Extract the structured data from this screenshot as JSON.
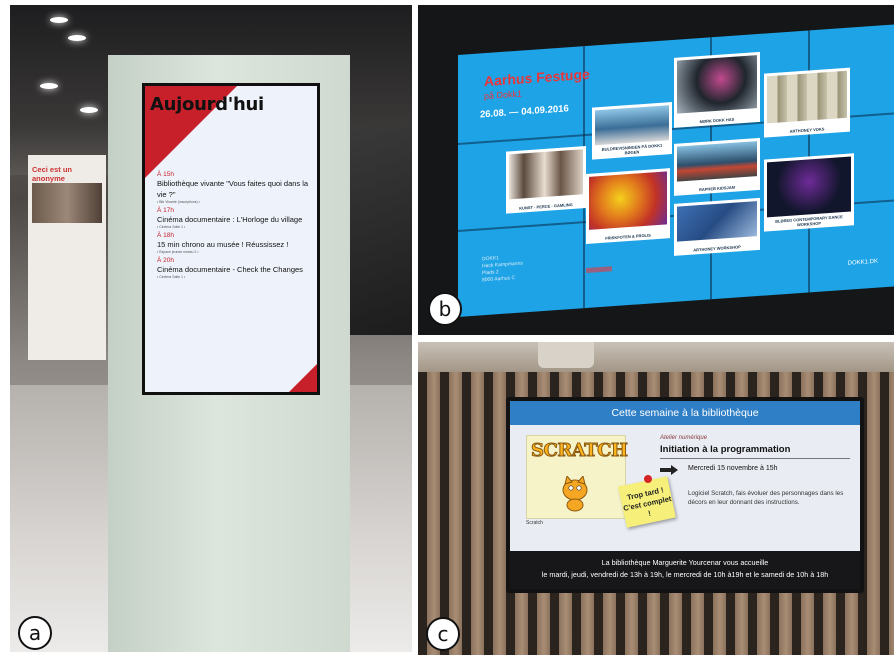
{
  "panels": {
    "a": {
      "label": "a",
      "screen": {
        "heading": "Aujourd'hui",
        "events": [
          {
            "time": "À 15h",
            "title": "Bibliothèque vivante \"Vous faites quoi dans la vie ?\"",
            "sub": "• Bib Vivante (inscriptions) •"
          },
          {
            "time": "À 17h",
            "title": "Cinéma documentaire : L'Horloge du village",
            "sub": "• Cinéma Salle 1 •"
          },
          {
            "time": "À 18h",
            "title": "15 min chrono au musée ! Réussissez !",
            "sub": "• Espace jeunes niveau 2 •"
          },
          {
            "time": "À 20h",
            "title": "Cinéma documentaire - Check the Changes",
            "sub": "• Cinéma Salle 1 •"
          }
        ]
      },
      "poster_title": "Ceci est un anonyme"
    },
    "b": {
      "label": "b",
      "festival_title": "Aarhus Festuge",
      "festival_subtitle": "på Dokk1",
      "festival_dates": "26.08. — 04.09.2016",
      "tiles": [
        {
          "caption": "KUNST · PERCE · GAMLING"
        },
        {
          "caption": "BULDREVISNINGEN PÅ DOKK1 BØGEN"
        },
        {
          "caption": "MØRK DOKK HAS"
        },
        {
          "caption": "ARTHONEY VOKS"
        },
        {
          "caption": "RAPHEB KIDSJAM"
        },
        {
          "caption": "FRISKFOTEN & PROLIS"
        },
        {
          "caption": "ARTHONEY WORKSHOP"
        },
        {
          "caption": "BLØRED CONTEMPORARY DANCE WORKSHOP"
        }
      ],
      "footer_link": "DOKK1.DK",
      "dokk_info": [
        "DOKK1",
        "Hack Kampmanns",
        "Plads 2",
        "8000 Aarhus C"
      ]
    },
    "c": {
      "label": "c",
      "header": "Cette semaine à la bibliothèque",
      "scratch_logo": "SCRATCH",
      "scratch_caption": "Scratch",
      "activity_type": "Atelier numérique",
      "activity_title": "Initiation à la programmation",
      "activity_date": "Mercredi 15 novembre à 15h",
      "description": "Logiciel Scratch, fais évoluer des personnages dans les décors en leur donnant des instructions.",
      "sticky_note": "Trop tard ! C'est complet !",
      "footer_line1": "La bibliothèque Marguerite Yourcenar vous accueille",
      "footer_line2": "le mardi, jeudi, vendredi de 13h à 19h, le mercredi de 10h à19h et le samedi de 10h à 18h"
    }
  },
  "colors": {
    "kiosk_red": "#c7202a",
    "wall_blue": "#1ea3e6",
    "festival_red": "#e8363a",
    "tv_header_blue": "#2f7fc6"
  }
}
